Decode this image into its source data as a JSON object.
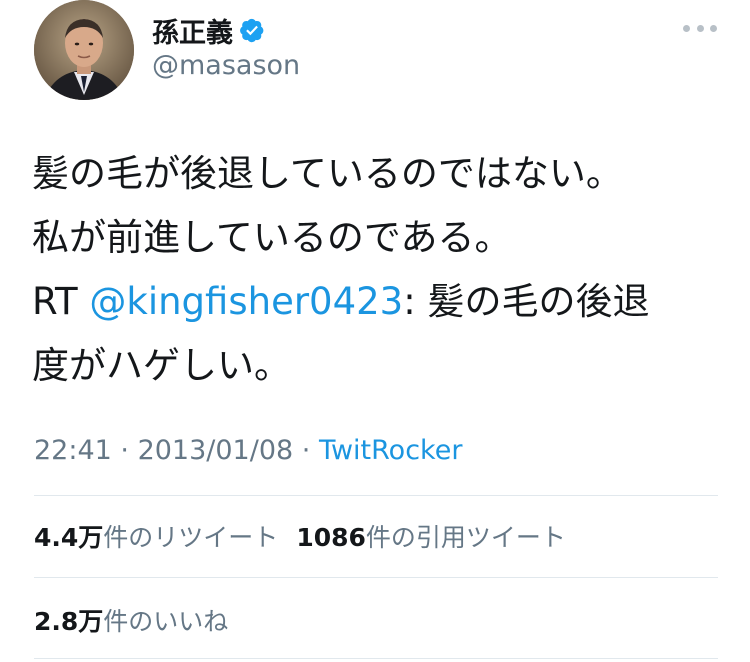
{
  "user": {
    "display_name": "孫正義",
    "handle": "@masason",
    "verified": true,
    "avatar_icon": "profile-photo"
  },
  "tweet": {
    "line1": "髪の毛が後退しているのではない。",
    "line2": "私が前進しているのである。",
    "rt_prefix": " RT ",
    "mention": "@kingfisher0423",
    "line3_rest": ": 髪の毛の後退",
    "line4": "度がハゲしい。"
  },
  "meta": {
    "time": "22:41",
    "sep1": " · ",
    "date": "2013/01/08",
    "sep2": " · ",
    "source": "TwitRocker"
  },
  "stats": {
    "retweets_count": "4.4万",
    "retweets_label": "件のリツイート",
    "quotes_count": "1086",
    "quotes_label": "件の引用ツイート",
    "likes_count": "2.8万",
    "likes_label": "件のいいね"
  },
  "colors": {
    "link": "#1b95e0",
    "secondary": "#657786",
    "divider": "#e1e8ed",
    "verified": "#1da1f2"
  }
}
